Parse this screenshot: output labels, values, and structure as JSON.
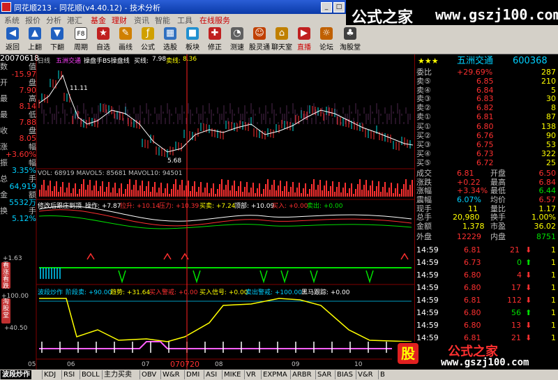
{
  "window": {
    "title": "同花顺213 - 同花顺(v4.40.12) - 技术分析",
    "min": "_",
    "max": "□",
    "close": "×"
  },
  "brand": {
    "name": "公式之家",
    "url": "www.gszj100.com"
  },
  "menu": [
    "系统",
    "报价",
    "分析",
    "港汇",
    "基金",
    "理财",
    "资讯",
    "智能",
    "工具",
    "在线服务"
  ],
  "toolbar": [
    {
      "label": "返回",
      "icon": "back-icon",
      "color": "#2060c0"
    },
    {
      "label": "上翻",
      "icon": "up-icon",
      "color": "#2060c0"
    },
    {
      "label": "下翻",
      "icon": "down-icon",
      "color": "#2060c0"
    },
    {
      "label": "周期",
      "icon": "period-icon",
      "color": "#404040",
      "glyph": "F8"
    },
    {
      "label": "自选",
      "icon": "favorites-icon",
      "color": "#c02020"
    },
    {
      "label": "画线",
      "icon": "draw-icon",
      "color": "#d08000"
    },
    {
      "label": "公式",
      "icon": "formula-icon",
      "color": "#d0a000"
    },
    {
      "label": "选股",
      "icon": "select-stock-icon",
      "color": "#3070c0"
    },
    {
      "label": "板块",
      "icon": "sector-icon",
      "color": "#2090d0"
    },
    {
      "label": "修正",
      "icon": "revise-icon",
      "color": "#c02020"
    },
    {
      "label": "测速",
      "icon": "speed-test-icon",
      "color": "#606060"
    },
    {
      "label": "股灵通",
      "icon": "stock-helper-icon",
      "color": "#c04000"
    },
    {
      "label": "聊天室",
      "icon": "chat-icon",
      "color": "#c08000"
    },
    {
      "label": "直播",
      "icon": "live-icon",
      "color": "#c02020"
    },
    {
      "label": "论坛",
      "icon": "forum-icon",
      "color": "#c06000"
    },
    {
      "label": "淘股堂",
      "icon": "stock-hall-icon",
      "color": "#404040"
    }
  ],
  "chart_header": {
    "period": "日线",
    "name": "五洲交通",
    "indicator": "操盘手BS操盘线",
    "buy_label": "买线:",
    "buy": "7.98",
    "sell_label": "卖线:",
    "sell": "8.36",
    "hi_mark": "11.11",
    "lo_mark": "5.68"
  },
  "left_panel": {
    "date": "20070618",
    "rows": [
      [
        "数",
        "值"
      ],
      [
        "-15.97",
        ""
      ],
      [
        "开",
        "盘"
      ],
      [
        "7.90",
        ""
      ],
      [
        "最",
        "高"
      ],
      [
        "8.14",
        ""
      ],
      [
        "最",
        "低"
      ],
      [
        "7.88",
        ""
      ],
      [
        "收",
        "盘"
      ],
      [
        "8.05",
        ""
      ],
      [
        "涨",
        "幅"
      ],
      [
        "+3.60%",
        ""
      ],
      [
        "振",
        "幅"
      ],
      [
        "3.35%",
        ""
      ],
      [
        "总",
        "手"
      ],
      [
        "64,919",
        ""
      ],
      [
        "金",
        "额"
      ],
      [
        "5532万",
        ""
      ],
      [
        "换",
        "手"
      ],
      [
        "5.12%",
        ""
      ]
    ]
  },
  "vol": {
    "text": "VOL: 68919  MAVOL5: 85681  MAVOL10: 94501"
  },
  "ind1": {
    "name": "修改后跟庄到顶",
    "a": "操作: +7.87",
    "b": "拉升: +10.14",
    "c": "压力: +10.39",
    "d": "买卖: +7.24",
    "e": "顶部: +10.09",
    "f": "买入: +0.00",
    "g": "卖出: +0.00"
  },
  "ind2": {
    "level": "+1.63",
    "tab": "看涨看跌"
  },
  "ind3": {
    "name": "波段炒作",
    "a": "阶段卖: +90.00",
    "b": "趋势: +31.64",
    "c": "买入警戒: +0.00",
    "d": "买入信号: +0.00",
    "e": "卖出警戒: +100.00",
    "f": "黑马跟踪: +0.00",
    "top": "+100.00",
    "mid": "+40.50",
    "tab": "淘股堂"
  },
  "xaxis": {
    "labels": [
      "05",
      "06",
      "07",
      "070720",
      "08",
      "09",
      "10"
    ]
  },
  "quote": {
    "stars": "★★★",
    "name": "五洲交通",
    "code": "600368",
    "weibi": [
      "委比",
      "+29.69%",
      "287"
    ],
    "sell": [
      [
        "卖⑤",
        "6.85",
        "210"
      ],
      [
        "卖④",
        "6.84",
        "5"
      ],
      [
        "卖③",
        "6.83",
        "30"
      ],
      [
        "卖②",
        "6.82",
        "8"
      ],
      [
        "卖①",
        "6.81",
        "87"
      ]
    ],
    "buy": [
      [
        "买①",
        "6.80",
        "138"
      ],
      [
        "买②",
        "6.76",
        "90"
      ],
      [
        "买③",
        "6.75",
        "53"
      ],
      [
        "买④",
        "6.73",
        "322"
      ],
      [
        "买⑤",
        "6.72",
        "25"
      ]
    ],
    "stats": [
      [
        "成交",
        "6.81",
        "开盘",
        "6.50"
      ],
      [
        "涨跌",
        "+0.22",
        "最高",
        "6.84"
      ],
      [
        "涨幅",
        "+3.34%",
        "最低",
        "6.44"
      ],
      [
        "震幅",
        "6.07%",
        "均价",
        "6.57"
      ],
      [
        "现手",
        "11",
        "量比",
        "1.17"
      ],
      [
        "总手",
        "20,980",
        "换手",
        "1.00%"
      ],
      [
        "金额",
        "1,378",
        "市盈",
        "36.02"
      ],
      [
        "外盘",
        "12229",
        "内盘",
        "8751"
      ]
    ],
    "ticks": [
      [
        "14:59",
        "6.81",
        "21",
        "down",
        "1"
      ],
      [
        "14:59",
        "6.73",
        "0",
        "up",
        "1"
      ],
      [
        "14:59",
        "6.80",
        "4",
        "down",
        "1"
      ],
      [
        "14:59",
        "6.80",
        "17",
        "down",
        "1"
      ],
      [
        "14:59",
        "6.81",
        "112",
        "down",
        "1"
      ],
      [
        "14:59",
        "6.80",
        "56",
        "up",
        "1"
      ],
      [
        "14:59",
        "6.80",
        "13",
        "down",
        "1"
      ],
      [
        "14:59",
        "6.81",
        "21",
        "down",
        "1"
      ]
    ]
  },
  "tabs": [
    "波段炒作",
    "KDJ",
    "RSI",
    "BOLL",
    "主力买卖",
    "OBV",
    "W&R",
    "DMI",
    "ASI",
    "MIKE",
    "VR",
    "EXPMA",
    "ARBR",
    "SAR",
    "BIAS",
    "V&R",
    "B"
  ],
  "colors": {
    "up": "#ff3030",
    "down": "#00e000",
    "accent": "#ffff00"
  }
}
